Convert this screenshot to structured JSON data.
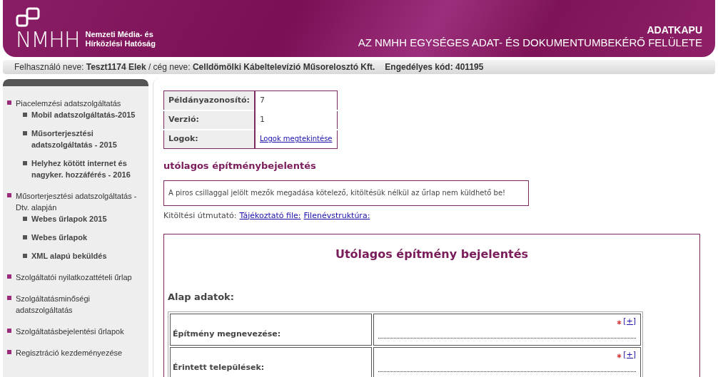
{
  "header": {
    "logo_mark": "NMHH",
    "logo_lines": [
      "Nemzeti Média- és",
      "Hírközlési Hatóság"
    ],
    "title": "ADATKAPU",
    "subtitle": "AZ NMHH EGYSÉGES ADAT- ÉS DOKUMENTUMBEKÉRŐ FELÜLETE"
  },
  "user_bar": {
    "user_info": "Felhasználó neve: **Teszt1174 Elek** / cég neve: **Celldömölki Kábeltelevízió Műsorelosztó Kft.**",
    "license_code": "Engedélyes kód: 401195"
  },
  "sidebar": {
    "items": [
      {
        "label": "Piacelemzési adatszolgáltatás",
        "children": [
          {
            "label": "Mobil adatszolgáltatás-2015"
          },
          {
            "label": "Műsorterjesztési adatszolgáltatás - 2015"
          },
          {
            "label": "Helyhez kötött internet és nagyker. hozzáférés - 2016"
          }
        ]
      },
      {
        "label": "Műsorterjesztési adatszolgáltatás - Dtv. alapján",
        "children": [
          {
            "label": "Webes űrlapok 2015"
          },
          {
            "label": "Webes űrlapok"
          },
          {
            "label": "XML alapú beküldés"
          }
        ]
      },
      {
        "label": "Szolgáltatói nyilatkozattételi űrlap"
      },
      {
        "label": "Szolgáltatásminőségi adatszolgáltatás"
      },
      {
        "label": "Szolgáltatásbejelentési űrlapok"
      },
      {
        "label": "Regisztráció kezdeményezése"
      }
    ]
  },
  "info_table": [
    {
      "label": "Példányazonosító:",
      "value": "7",
      "kind": "text"
    },
    {
      "label": "Verzió:",
      "value": "1",
      "kind": "text"
    },
    {
      "label": "Logok:",
      "value": "Logok megtekintése",
      "kind": "link"
    }
  ],
  "section_title": "utólagos építménybejelentés",
  "notice": "A piros csillaggal jelölt mezők megadása kötelező, kitöltésük nélkül az űrlap nem küldhető be!",
  "guide": {
    "label": "Kitöltési útmutató:",
    "links": [
      "Tájékoztató file:",
      "Filenévstruktúra:"
    ]
  },
  "form": {
    "title": "Utólagos építmény bejelentés",
    "group_title": "Alap adatok:",
    "fields": [
      {
        "label": "Építmény megnevezése:",
        "required": true,
        "add_link": "[+]"
      },
      {
        "label": "Érintett települések:",
        "required": true,
        "add_link": "[+]"
      }
    ]
  }
}
